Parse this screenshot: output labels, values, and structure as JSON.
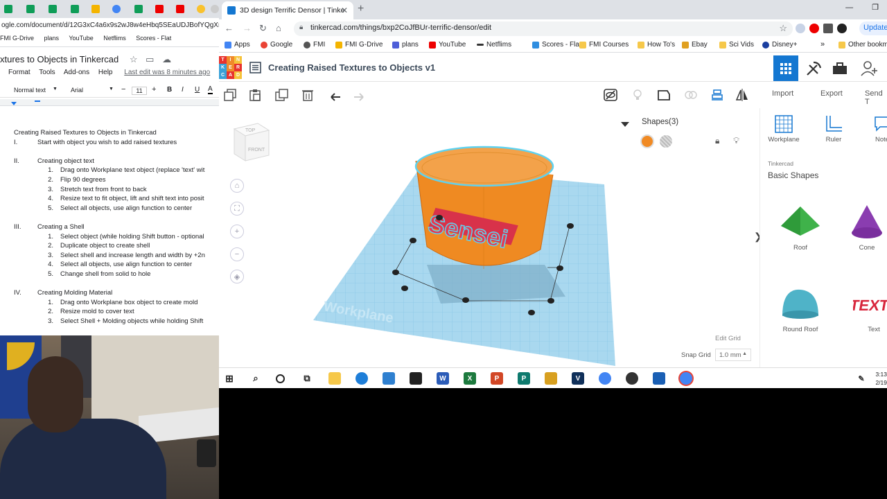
{
  "docs": {
    "url": "ogle.com/document/d/12G3xC4a6x9s2wJ8w4eHbq5SEaUDJBofYQgXrCR",
    "bookmarks": [
      "FMI G-Drive",
      "plans",
      "YouTube",
      "Netflims",
      "Scores - Flat"
    ],
    "doc_title": "xtures to Objects in Tinkercad",
    "menu": [
      "Format",
      "Tools",
      "Add-ons",
      "Help"
    ],
    "last_edit": "Last edit was 8 minutes ago",
    "toolbar": {
      "style": "Normal text",
      "font": "Arial",
      "size": "11"
    },
    "heading": "Creating Raised Textures to Objects in Tinkercad",
    "outline": [
      {
        "num": "I.",
        "text": "Start with object you wish to add raised textures",
        "level": 1
      },
      {
        "num": "",
        "text": "",
        "level": 0
      },
      {
        "num": "II.",
        "text": "Creating object text",
        "level": 1
      },
      {
        "num": "1.",
        "text": "Drag onto Workplane text object (replace 'text' wit",
        "level": 2
      },
      {
        "num": "2.",
        "text": "Flip 90 degrees",
        "level": 2
      },
      {
        "num": "3.",
        "text": "Stretch text from front to back",
        "level": 2
      },
      {
        "num": "4.",
        "text": "Resize text to fit object, lift and shift text into posit",
        "level": 2
      },
      {
        "num": "5.",
        "text": "Select all objects, use align function to center",
        "level": 2
      },
      {
        "num": "",
        "text": "",
        "level": 0
      },
      {
        "num": "III.",
        "text": "Creating a Shell",
        "level": 1
      },
      {
        "num": "1.",
        "text": "Select object (while holding Shift button - optional",
        "level": 2
      },
      {
        "num": "2.",
        "text": "Duplicate object to create shell",
        "level": 2
      },
      {
        "num": "3.",
        "text": "Select shell and increase length and width by +2n",
        "level": 2
      },
      {
        "num": "4.",
        "text": "Select all objects, use align function to center",
        "level": 2
      },
      {
        "num": "5.",
        "text": "Change shell from solid to hole",
        "level": 2
      },
      {
        "num": "",
        "text": "",
        "level": 0
      },
      {
        "num": "IV.",
        "text": "Creating Molding Material",
        "level": 1
      },
      {
        "num": "1.",
        "text": "Drag onto Workplane box object to create mold",
        "level": 2
      },
      {
        "num": "2.",
        "text": "Resize mold to cover text",
        "level": 2
      },
      {
        "num": "3.",
        "text": "Select Shell + Molding objects while holding Shift",
        "level": 2
      }
    ]
  },
  "browser": {
    "tab_title": "3D design Terrific Densor | Tinke",
    "url": "tinkercad.com/things/bxp2CoJfBUr-terrific-densor/edit",
    "update_label": "Update",
    "bookmarks": [
      "Apps",
      "Google",
      "FMI",
      "FMI G-Drive",
      "plans",
      "YouTube",
      "Netflims",
      "Scores - Flat",
      "FMI Courses",
      "How To's",
      "Ebay",
      "Sci Vids",
      "Disney+",
      "Other bookm"
    ]
  },
  "tinkercad": {
    "logo_letters": [
      "T",
      "I",
      "N",
      "K",
      "E",
      "R",
      "C",
      "A",
      "D"
    ],
    "design_title": "Creating Raised Textures to Objects v1",
    "toolbar": {
      "import": "Import",
      "export": "Export",
      "send_to": "Send T"
    },
    "view_cube": {
      "top": "TOP",
      "front": "FRONT"
    },
    "shapes_panel_title": "Shapes(3)",
    "workplane_label": "Workplane",
    "text_object": "Sensei",
    "edit_grid": "Edit Grid",
    "snap_grid_label": "Snap Grid",
    "snap_grid_value": "1.0 mm",
    "library": {
      "tools": [
        "Workplane",
        "Ruler",
        "Note"
      ],
      "source": "Tinkercad",
      "category": "Basic Shapes",
      "shapes": [
        "Roof",
        "Cone",
        "Round Roof",
        "Text"
      ],
      "text_shape_preview": "TEXT"
    },
    "colors": {
      "orange": "#f08a24",
      "hole": "#bbbbbb",
      "grid": "#a9d8ef",
      "text": "#e8384f",
      "accent": "#1477d1"
    }
  },
  "taskbar": {
    "time": "3:13",
    "date": "2/19"
  }
}
